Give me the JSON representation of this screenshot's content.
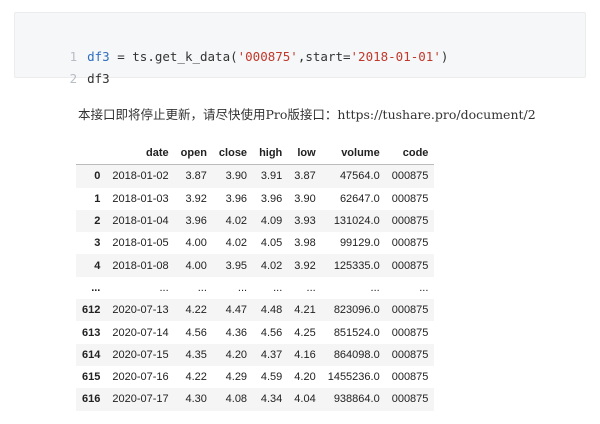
{
  "code": {
    "lines": [
      {
        "no": "1",
        "var": "df3",
        "op": " = ts.get_k_data(",
        "arg1": "'000875'",
        "mid": ",start=",
        "arg2": "'2018-01-01'",
        "end": ")"
      },
      {
        "no": "2",
        "text": "df3"
      }
    ]
  },
  "notice": "本接口即将停止更新，请尽快使用Pro版接口：https://tushare.pro/document/2",
  "table": {
    "columns": [
      "",
      "date",
      "open",
      "close",
      "high",
      "low",
      "volume",
      "code"
    ],
    "rows": [
      [
        "0",
        "2018-01-02",
        "3.87",
        "3.90",
        "3.91",
        "3.87",
        "47564.0",
        "000875"
      ],
      [
        "1",
        "2018-01-03",
        "3.92",
        "3.96",
        "3.96",
        "3.90",
        "62647.0",
        "000875"
      ],
      [
        "2",
        "2018-01-04",
        "3.96",
        "4.02",
        "4.09",
        "3.93",
        "131024.0",
        "000875"
      ],
      [
        "3",
        "2018-01-05",
        "4.00",
        "4.02",
        "4.05",
        "3.98",
        "99129.0",
        "000875"
      ],
      [
        "4",
        "2018-01-08",
        "4.00",
        "3.95",
        "4.02",
        "3.92",
        "125335.0",
        "000875"
      ],
      [
        "...",
        "...",
        "...",
        "...",
        "...",
        "...",
        "...",
        "..."
      ],
      [
        "612",
        "2020-07-13",
        "4.22",
        "4.47",
        "4.48",
        "4.21",
        "823096.0",
        "000875"
      ],
      [
        "613",
        "2020-07-14",
        "4.56",
        "4.36",
        "4.56",
        "4.25",
        "851524.0",
        "000875"
      ],
      [
        "614",
        "2020-07-15",
        "4.35",
        "4.20",
        "4.37",
        "4.16",
        "864098.0",
        "000875"
      ],
      [
        "615",
        "2020-07-16",
        "4.22",
        "4.29",
        "4.59",
        "4.20",
        "1455236.0",
        "000875"
      ],
      [
        "616",
        "2020-07-17",
        "4.30",
        "4.08",
        "4.34",
        "4.04",
        "938864.0",
        "000875"
      ]
    ]
  }
}
